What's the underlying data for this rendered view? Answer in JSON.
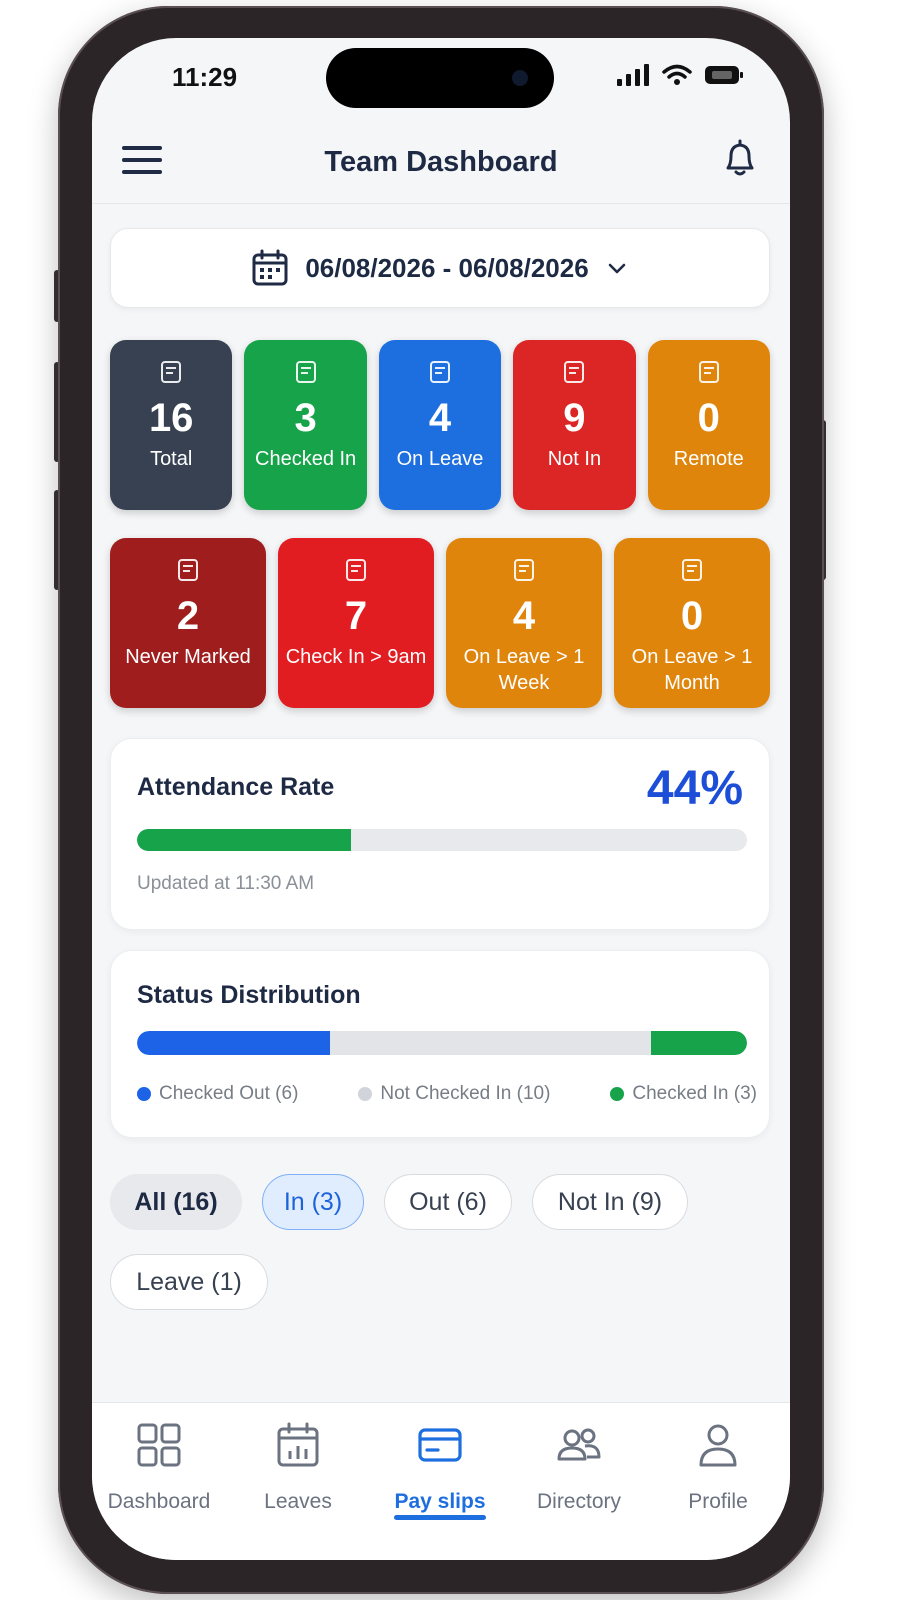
{
  "status_bar": {
    "time": "11:29"
  },
  "header": {
    "title": "Team Dashboard"
  },
  "date_range": {
    "label": "06/08/2026 - 06/08/2026"
  },
  "stats_row1": [
    {
      "value": "16",
      "label": "Total",
      "color": "#374151",
      "icon": "id-card-icon"
    },
    {
      "value": "3",
      "label": "Checked In",
      "color": "#16a34a",
      "icon": "edit-check-icon"
    },
    {
      "value": "4",
      "label": "On Leave",
      "color": "#1d6fe0",
      "icon": "leave-calendar-icon"
    },
    {
      "value": "9",
      "label": "Not In",
      "color": "#dc2626",
      "icon": "alert-icon"
    },
    {
      "value": "0",
      "label": "Remote",
      "color": "#e0850c",
      "icon": "home-doc-icon"
    }
  ],
  "stats_row2": [
    {
      "value": "2",
      "label": "Never Marked",
      "color": "#9f1d1d",
      "icon": "edit-icon"
    },
    {
      "value": "7",
      "label": "Check In > 9am",
      "color": "#e11d22",
      "icon": "clock-doc-icon"
    },
    {
      "value": "4",
      "label": "On Leave > 1 Week",
      "color": "#e0850c",
      "icon": "week-calendar-icon"
    },
    {
      "value": "0",
      "label": "On Leave > 1 Month",
      "color": "#e0850c",
      "icon": "month-calendar-icon"
    }
  ],
  "attendance": {
    "title": "Attendance Rate",
    "rate_label": "44%",
    "rate": 0.35,
    "updated": "Updated at 11:30 AM"
  },
  "distribution": {
    "title": "Status Distribution",
    "segments": [
      {
        "label": "Checked Out (6)",
        "count": 6,
        "color": "#1d63e8"
      },
      {
        "label": "Not Checked In (10)",
        "count": 10,
        "color": "#d1d5db"
      },
      {
        "label": "Checked In (3)",
        "count": 3,
        "color": "#16a34a"
      }
    ]
  },
  "filters": [
    {
      "label": "All (16)"
    },
    {
      "label": "In (3)"
    },
    {
      "label": "Out (6)"
    },
    {
      "label": "Not In (9)"
    },
    {
      "label": "Leave (1)"
    }
  ],
  "bottom_nav": [
    {
      "label": "Dashboard",
      "icon": "grid-icon"
    },
    {
      "label": "Leaves",
      "icon": "calendar-icon"
    },
    {
      "label": "Pay slips",
      "icon": "card-icon",
      "active": true
    },
    {
      "label": "Directory",
      "icon": "people-icon"
    },
    {
      "label": "Profile",
      "icon": "person-icon"
    }
  ]
}
